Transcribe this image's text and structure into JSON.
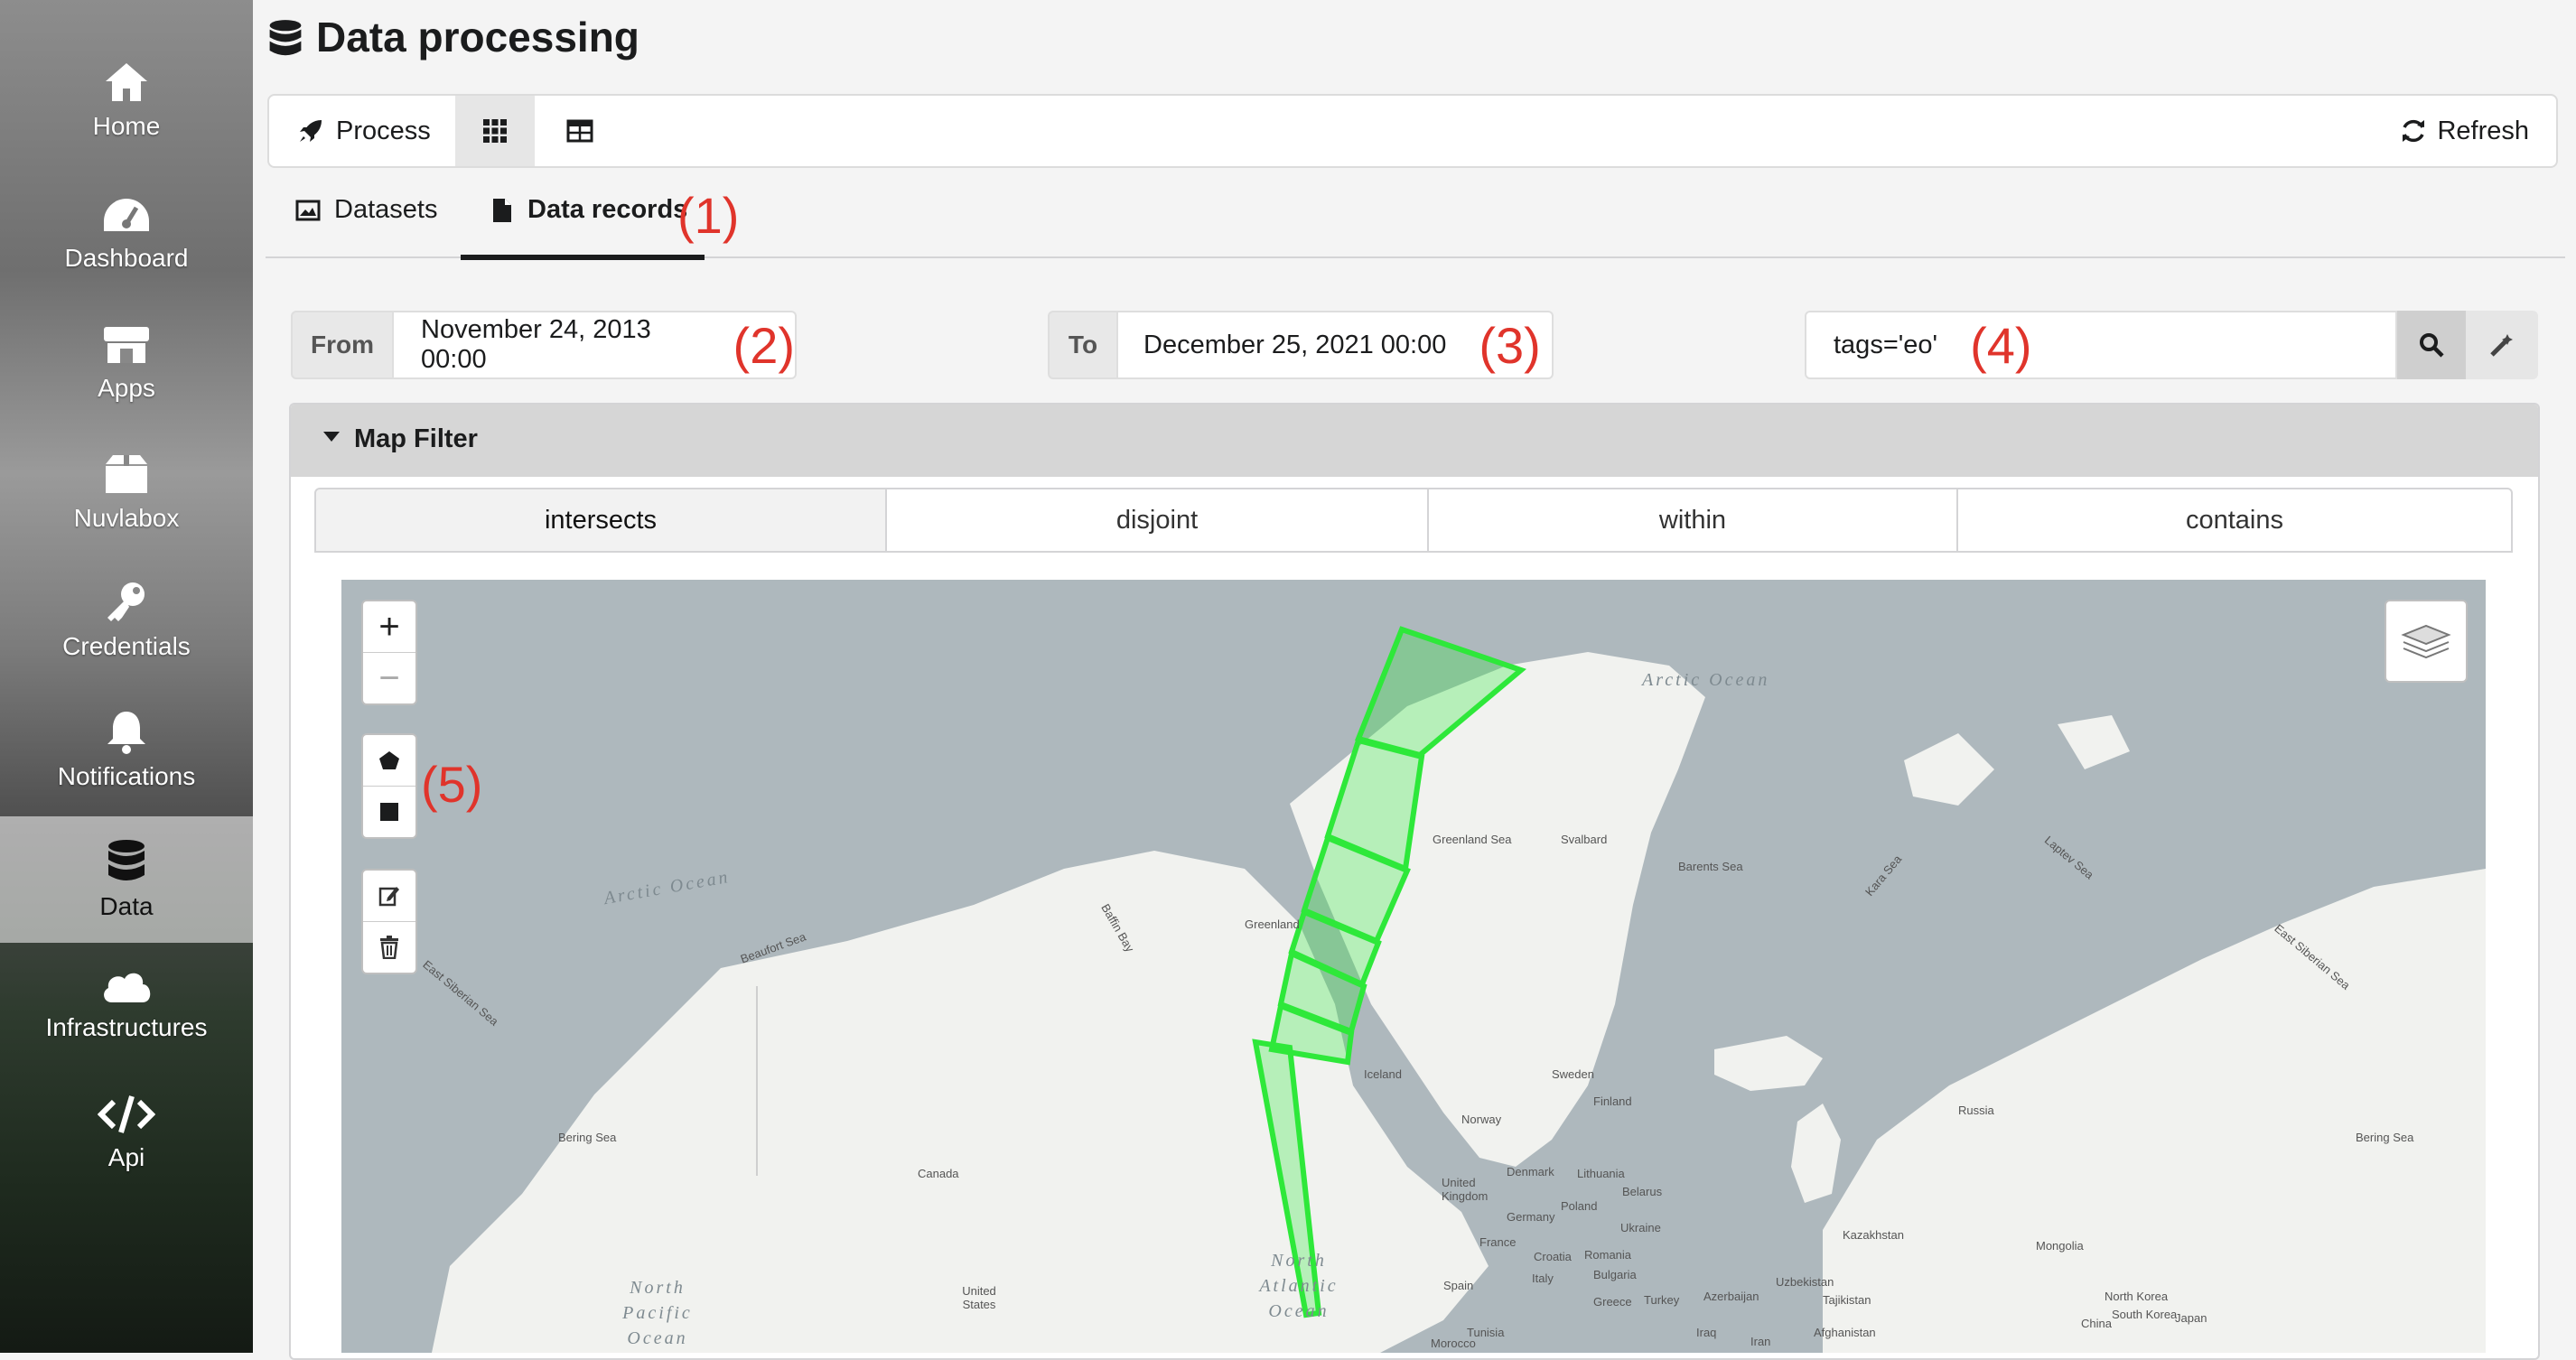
{
  "sidebar": {
    "items": [
      {
        "label": "Home",
        "icon": "home-icon"
      },
      {
        "label": "Dashboard",
        "icon": "dashboard-icon"
      },
      {
        "label": "Apps",
        "icon": "store-icon"
      },
      {
        "label": "Nuvlabox",
        "icon": "box-icon"
      },
      {
        "label": "Credentials",
        "icon": "key-icon"
      },
      {
        "label": "Notifications",
        "icon": "bell-icon"
      },
      {
        "label": "Data",
        "icon": "database-icon"
      },
      {
        "label": "Infrastructures",
        "icon": "cloud-icon"
      },
      {
        "label": "Api",
        "icon": "code-icon"
      }
    ],
    "active": "Data"
  },
  "header": {
    "title": "Data processing",
    "icon": "database-icon"
  },
  "toolbar": {
    "process_label": "Process",
    "grid_icon": "grid-icon",
    "table_icon": "table-icon",
    "refresh_label": "Refresh"
  },
  "tabs": [
    {
      "label": "Datasets",
      "icon": "image-icon"
    },
    {
      "label": "Data records",
      "icon": "file-icon"
    }
  ],
  "annotations": [
    "(1)",
    "(2)",
    "(3)",
    "(4)",
    "(5)"
  ],
  "filters": {
    "from_label": "From",
    "from_value": "November 24, 2013 00:00",
    "to_label": "To",
    "to_value": "December 25, 2021 00:00",
    "query_value": "tags='eo'"
  },
  "map_filter": {
    "title": "Map Filter",
    "tabs": [
      "intersects",
      "disjoint",
      "within",
      "contains"
    ],
    "active_tab": "intersects"
  },
  "map": {
    "zoom_in": "+",
    "zoom_out": "−",
    "oceans": [
      "Arctic Ocean",
      "Arctic Ocean",
      "North Atlantic Ocean",
      "North Pacific Ocean"
    ],
    "seas": [
      "Greenland Sea",
      "Barents Sea",
      "Kara Sea",
      "Laptev Sea",
      "East Siberian Sea",
      "Beaufort Sea",
      "Baffin Bay",
      "Bering Sea",
      "Bering Sea",
      "East Siberian Sea"
    ],
    "places": [
      "Greenland",
      "Svalbard",
      "Iceland",
      "Sweden",
      "Finland",
      "Norway",
      "Russia",
      "Canada",
      "United States",
      "Denmark",
      "Lithuania",
      "Belarus",
      "Poland",
      "Germany",
      "Ukraine",
      "France",
      "Croatia",
      "Romania",
      "Bulgaria",
      "Italy",
      "Spain",
      "Turkey",
      "Greece",
      "Kazakhstan",
      "Mongolia",
      "Uzbekistan",
      "Tajikistan",
      "Azerbaijan",
      "Iraq",
      "Iran",
      "Afghanistan",
      "Tunisia",
      "Morocco",
      "China",
      "North Korea",
      "South Korea",
      "Japan",
      "United Kingdom"
    ],
    "footprint_color": "#2ee83a"
  }
}
